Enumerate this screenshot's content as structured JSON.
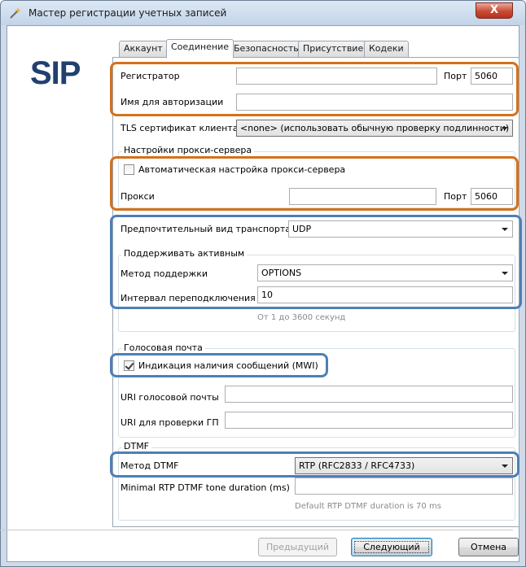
{
  "window": {
    "title": "Мастер регистрации учетных записей",
    "close_label": "X"
  },
  "logo": {
    "text": "SIP"
  },
  "tabs": [
    {
      "label": "Аккаунт",
      "active": false
    },
    {
      "label": "Соединение",
      "active": true
    },
    {
      "label": "Безопасность",
      "active": false
    },
    {
      "label": "Присутствие",
      "active": false
    },
    {
      "label": "Кодеки",
      "active": false
    }
  ],
  "registrar": {
    "label": "Регистратор",
    "value": "",
    "port_label": "Порт",
    "port_value": "5060"
  },
  "auth_name": {
    "label": "Имя для авторизации",
    "value": ""
  },
  "tls_cert": {
    "label": "TLS сертификат клиента",
    "value": "<none> (использовать обычную проверку подлинности)"
  },
  "proxy_settings": {
    "title": "Настройки прокси-сервера",
    "auto_label": "Автоматическая настройка прокси-сервера",
    "auto_checked": false,
    "proxy_label": "Прокси",
    "proxy_value": "",
    "port_label": "Порт",
    "port_value": "5060"
  },
  "transport": {
    "label": "Предпочтительный вид транспорта",
    "value": "UDP"
  },
  "keep_alive": {
    "title": "Поддерживать активным",
    "method_label": "Метод поддержки",
    "method_value": "OPTIONS",
    "interval_label": "Интервал переподключения",
    "interval_value": "10",
    "interval_hint": "От 1 до 3600 секунд"
  },
  "voicemail": {
    "title": "Голосовая почта",
    "mwi_label": "Индикация наличия сообщений (MWI)",
    "mwi_checked": true,
    "uri_label": "URI голосовой почты",
    "uri_value": "",
    "check_uri_label": "URI для проверки ГП",
    "check_uri_value": ""
  },
  "dtmf": {
    "title": "DTMF",
    "method_label": "Метод DTMF",
    "method_value": "RTP (RFC2833 / RFC4733)",
    "duration_label": "Minimal RTP DTMF tone duration (ms)",
    "duration_value": "",
    "duration_hint": "Default RTP DTMF duration is 70 ms"
  },
  "buttons": {
    "prev_label": "Предыдущий",
    "next_label": "Следующий",
    "cancel_label": "Отмена"
  },
  "colors": {
    "highlight_orange": "#d4711c",
    "highlight_blue": "#4e7fb7",
    "logo": "#21406f"
  }
}
